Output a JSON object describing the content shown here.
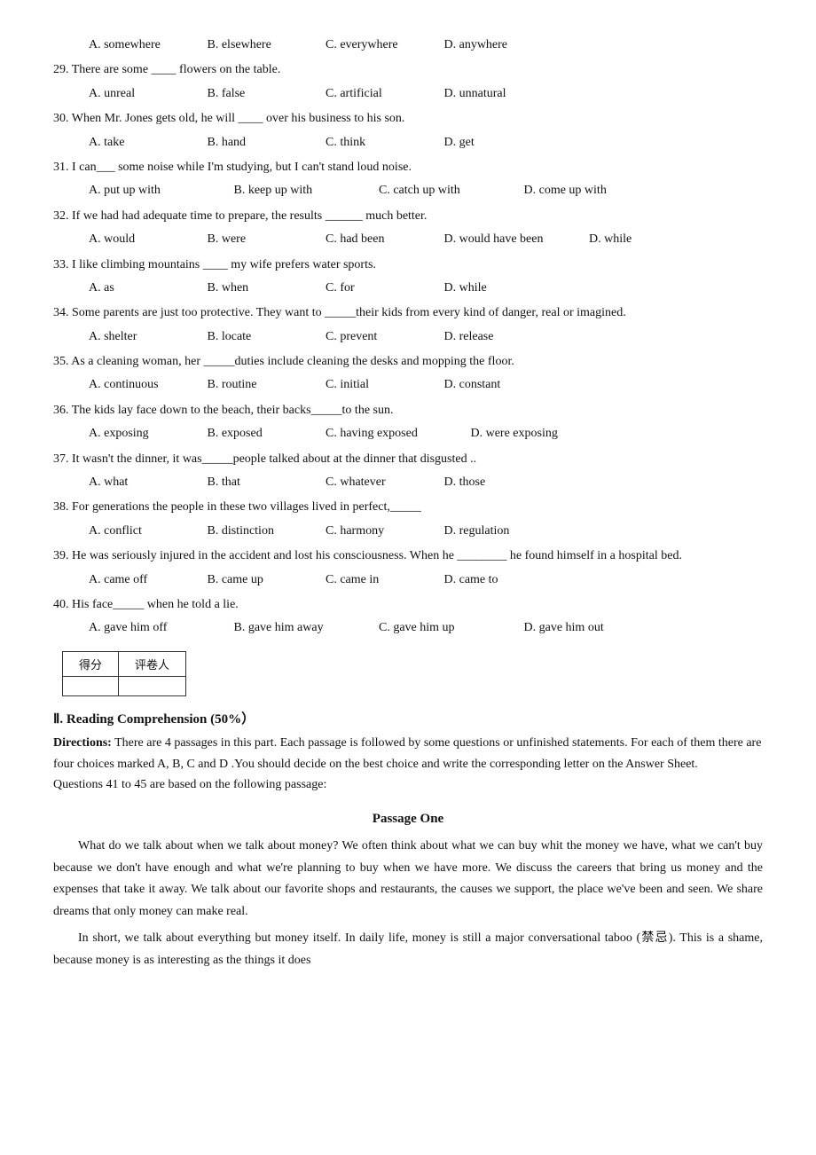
{
  "questions": [
    {
      "id": "q28_options",
      "options": [
        "A. somewhere",
        "B. elsewhere",
        "C. everywhere",
        "D. anywhere"
      ]
    },
    {
      "id": "q29",
      "text": "29. There are some ____ flowers on the table.",
      "options": [
        "A. unreal",
        "B. false",
        "C. artificial",
        "D. unnatural"
      ]
    },
    {
      "id": "q30",
      "text": "30. When Mr. Jones gets old, he will ____ over his business to his son.",
      "options": [
        "A. take",
        "B. hand",
        "C. think",
        "D. get"
      ]
    },
    {
      "id": "q31",
      "text": "31. I can___ some noise while I'm studying, but I can't stand loud noise.",
      "options": [
        "A. put up with",
        "B. keep up with",
        "C. catch up with",
        "D. come up with"
      ]
    },
    {
      "id": "q32",
      "text": "32. If we had had adequate time to prepare, the results ______ much better.",
      "options": [
        "A. would",
        "B. were",
        "C. had been",
        "D. would have been",
        "D. while"
      ]
    },
    {
      "id": "q33",
      "text": "33. I like climbing mountains ____ my wife prefers water sports.",
      "options": [
        "A. as",
        "B. when",
        "C. for",
        "D. while"
      ]
    },
    {
      "id": "q34",
      "text": "34. Some parents are just too protective. They want to _____their kids from every kind of danger, real or imagined.",
      "options": [
        "A. shelter",
        "B. locate",
        "C. prevent",
        "D. release"
      ]
    },
    {
      "id": "q35",
      "text": "35. As a cleaning woman, her _____duties include cleaning the desks and mopping the floor.",
      "options": [
        "A. continuous",
        "B. routine",
        "C. initial",
        "D. constant"
      ]
    },
    {
      "id": "q36",
      "text": "36. The kids lay face down to the beach, their backs_____to the sun.",
      "options": [
        "A. exposing",
        "B. exposed",
        "C. having exposed",
        "D. were exposing"
      ]
    },
    {
      "id": "q37",
      "text": "37. It wasn't the dinner, it was_____people talked about at the dinner that disgusted ..",
      "options": [
        "A. what",
        "B. that",
        "C. whatever",
        "D. those"
      ]
    },
    {
      "id": "q38",
      "text": "38. For generations the people in these two villages lived in perfect,_____",
      "options": [
        "A. conflict",
        "B. distinction",
        "C. harmony",
        "D. regulation"
      ]
    },
    {
      "id": "q39",
      "text": "39. He was seriously injured in the accident and lost his consciousness. When he ________ he found himself in a hospital bed.",
      "options": [
        "A. came off",
        "B. came up",
        "C. came in",
        "D. came to"
      ]
    },
    {
      "id": "q40",
      "text": "40. His face_____ when he told a lie.",
      "options": [
        "A. gave him off",
        "B. gave him away",
        "C. gave him up",
        "D. gave him out"
      ]
    }
  ],
  "score_table": {
    "col1": "得分",
    "col2": "评卷人"
  },
  "section2": {
    "header": "Ⅱ. Reading Comprehension (50%）",
    "directions_label": "Directions:",
    "directions_text": " There are 4 passages in this part. Each passage is followed by some questions or unfinished statements. For each of them there are four choices marked A, B, C and D .You should decide on the best choice and write the corresponding letter on the Answer Sheet.",
    "questions_note": "Questions 41 to 45 are based on the following passage:"
  },
  "passage": {
    "title": "Passage   One",
    "p1": "What do we talk about when we talk about money? We often think about what we can buy whit the money we have, what we can't buy because we don't have enough and what we're planning to buy when we have more. We discuss the careers that bring us money and the expenses that take it away. We talk about our favorite shops and restaurants, the causes we support, the place we've been and seen. We share dreams that only money can make real.",
    "p2": "In short, we talk about everything but money itself. In daily life, money is still a major conversational taboo (禁忌). This is a shame, because money is as interesting as the things it does"
  }
}
